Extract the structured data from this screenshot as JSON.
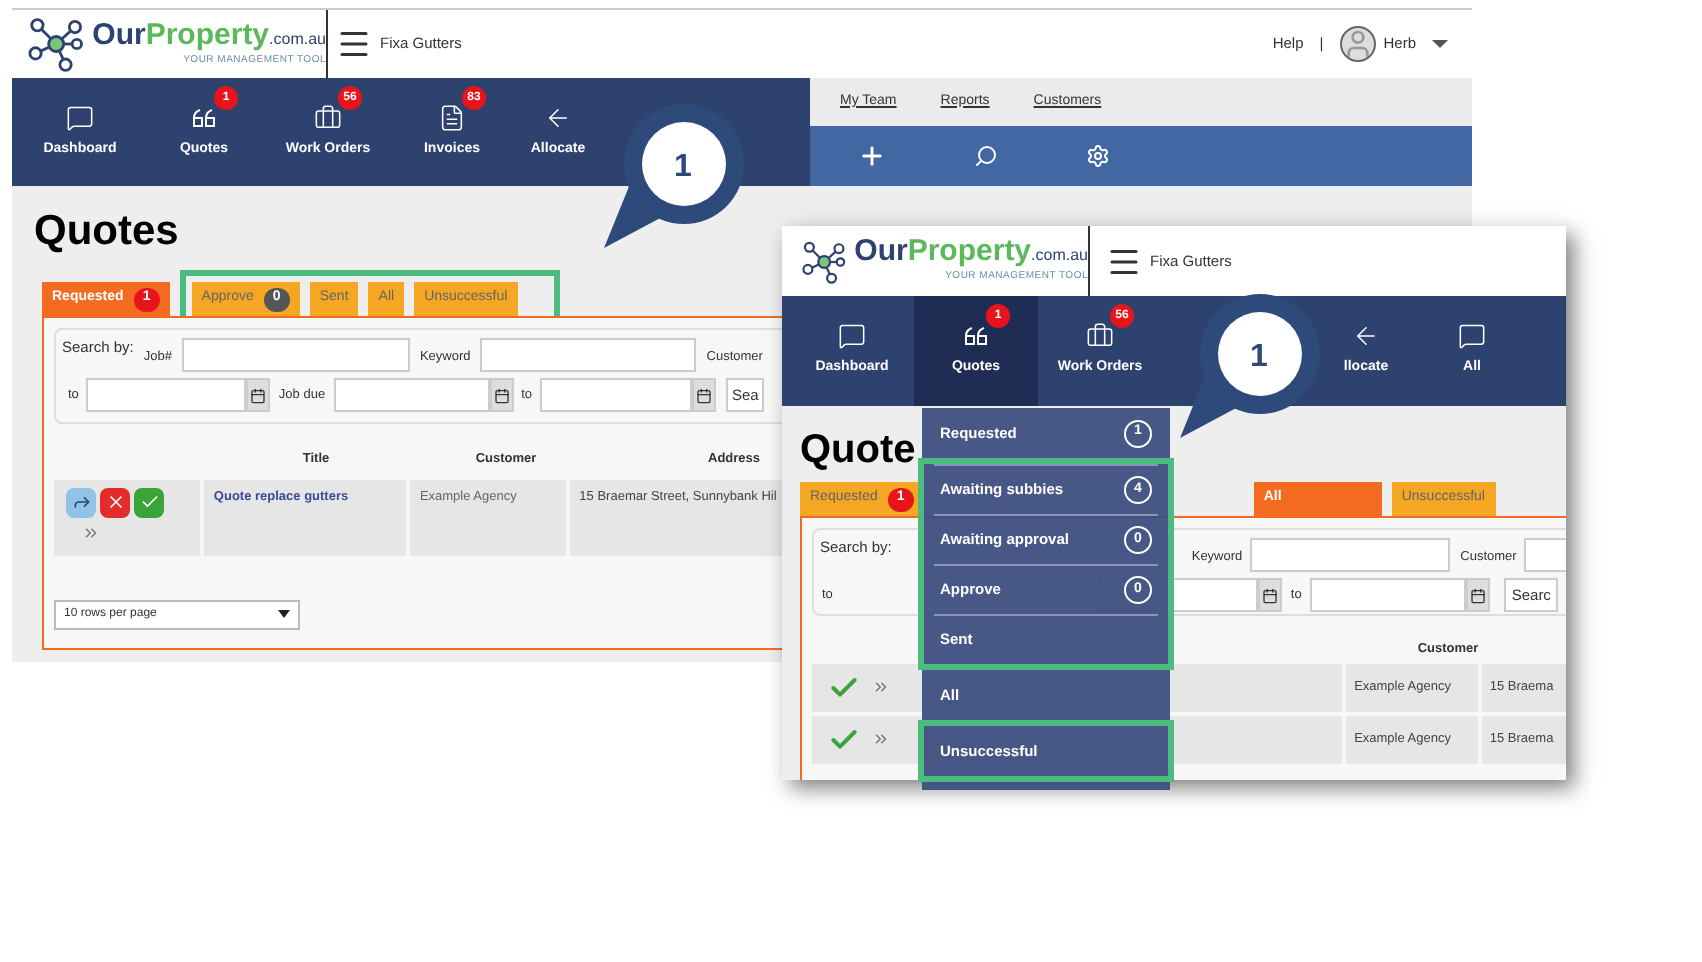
{
  "main_screen": {
    "brand": {
      "first": "Our",
      "second": "Property",
      "domain": ".com.au",
      "tagline": "YOUR MANAGEMENT TOOL"
    },
    "company": "Fixa Gutters",
    "help": "Help",
    "separator": "|",
    "user": "Herb",
    "nav": [
      {
        "label": "Dashboard",
        "selected": false
      },
      {
        "label": "Quotes",
        "badge": "1",
        "selected": false
      },
      {
        "label": "Work Orders",
        "badge": "56",
        "selected": false
      },
      {
        "label": "Invoices",
        "badge": "83",
        "selected": false
      },
      {
        "label": "Allocate",
        "selected": false
      }
    ],
    "sub_links": [
      "My Team",
      "Reports",
      "Customers"
    ],
    "title": "Quotes",
    "tabs": [
      {
        "label": "Requested",
        "count": "1",
        "selected": true,
        "highlighted": false
      },
      {
        "label": "Approve",
        "count": "0",
        "selected": false,
        "highlighted": true
      },
      {
        "label": "Sent",
        "selected": false,
        "highlighted": true
      },
      {
        "label": "All",
        "selected": false,
        "highlighted": true
      },
      {
        "label": "Unsuccessful",
        "selected": false,
        "highlighted": true
      }
    ],
    "search": {
      "label": "Search by:",
      "job": "Job#",
      "keyword": "Keyword",
      "customer": "Customer",
      "from_to": "to",
      "job_due": "Job due",
      "due_to": "to",
      "button": "Sea"
    },
    "table": {
      "columns": [
        "Title",
        "Customer",
        "Address"
      ],
      "rows": [
        {
          "title": "Quote replace gutters",
          "customer": "Example Agency",
          "address": "15 Braemar Street, Sunnybank Hil"
        }
      ]
    },
    "page_size": "10 rows per page"
  },
  "overlay_screen": {
    "brand": {
      "first": "Our",
      "second": "Property",
      "domain": ".com.au",
      "tagline": "YOUR MANAGEMENT TOOL"
    },
    "company": "Fixa Gutters",
    "nav": [
      {
        "label": "Dashboard",
        "selected": false
      },
      {
        "label": "Quotes",
        "badge": "1",
        "selected": true
      },
      {
        "label": "Work Orders",
        "badge": "56",
        "selected": false
      },
      {
        "label": "llocate",
        "selected": false
      },
      {
        "label": "All",
        "selected": false
      }
    ],
    "title": "Quote",
    "tabs": [
      {
        "label": "Requested",
        "count": "1",
        "selected": false
      },
      {
        "label": "All",
        "selected": true
      },
      {
        "label": "Unsuccessful",
        "selected": false
      }
    ],
    "search": {
      "label": "Search by:",
      "keyword": "Keyword",
      "customer": "Customer",
      "from_to": "to",
      "due_to": "to",
      "button": "Searc"
    },
    "table": {
      "columns": [
        "Customer"
      ],
      "rows": [
        {
          "customer": "Example Agency",
          "address": "15 Braema"
        },
        {
          "customer": "Example Agency",
          "address": "15 Braema"
        }
      ]
    },
    "menu": [
      {
        "label": "Requested",
        "count": "1",
        "highlighted": false
      },
      {
        "label": "Awaiting subbies",
        "count": "4",
        "highlighted": true
      },
      {
        "label": "Awaiting approval",
        "count": "0",
        "highlighted": true
      },
      {
        "label": "Approve",
        "count": "0",
        "highlighted": true
      },
      {
        "label": "Sent",
        "highlighted": true
      },
      {
        "label": "All",
        "highlighted": false
      },
      {
        "label": "Unsuccessful",
        "highlighted": true
      }
    ]
  },
  "callouts": [
    {
      "label": "1"
    },
    {
      "label": "1"
    }
  ]
}
